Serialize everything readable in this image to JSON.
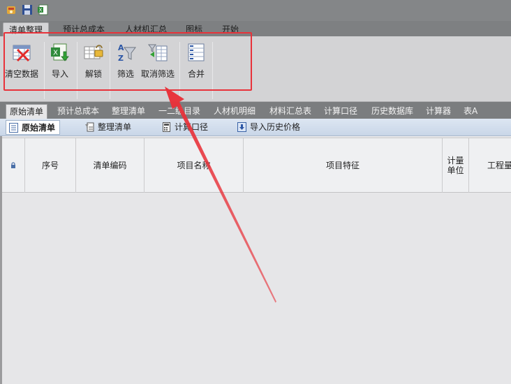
{
  "quick_access": {
    "icons": [
      "app-icon",
      "save-icon",
      "excel-icon"
    ]
  },
  "ribbon_tabs": [
    {
      "label": "清单整理",
      "active": true
    },
    {
      "label": "预计总成本",
      "active": false
    },
    {
      "label": "人材机汇总",
      "active": false
    },
    {
      "label": "图标",
      "active": false
    },
    {
      "label": "开始",
      "active": false
    }
  ],
  "ribbon": {
    "buttons": [
      {
        "label": "清空数据",
        "icon": "clear-data-icon"
      },
      {
        "label": "导入",
        "icon": "import-icon"
      },
      {
        "label": "解锁",
        "icon": "unlock-icon"
      },
      {
        "label": "筛选",
        "icon": "filter-icon"
      },
      {
        "label": "取消筛选",
        "icon": "cancel-filter-icon"
      },
      {
        "label": "合并",
        "icon": "merge-icon"
      }
    ]
  },
  "sheet_tabs": [
    {
      "label": "原始清单",
      "active": true
    },
    {
      "label": "预计总成本",
      "active": false
    },
    {
      "label": "整理清单",
      "active": false
    },
    {
      "label": "一二级目录",
      "active": false
    },
    {
      "label": "人材机明细",
      "active": false
    },
    {
      "label": "材料汇总表",
      "active": false
    },
    {
      "label": "计算口径",
      "active": false
    },
    {
      "label": "历史数据库",
      "active": false
    },
    {
      "label": "计算器",
      "active": false
    },
    {
      "label": "表A",
      "active": false
    }
  ],
  "sub_tabs": [
    {
      "label": "原始清单",
      "active": true,
      "icon": "list-icon"
    },
    {
      "label": "整理清单",
      "active": false,
      "icon": "organize-icon"
    },
    {
      "label": "计算口径",
      "active": false,
      "icon": "calc-icon"
    },
    {
      "label": "导入历史价格",
      "active": false,
      "icon": "import-history-icon"
    }
  ],
  "table": {
    "columns": [
      "序号",
      "清单编码",
      "项目名称",
      "项目特征",
      "计量\n单位",
      "工程量"
    ]
  },
  "annotation": {
    "highlight_color": "#e8323a",
    "arrow_color": "#e8323a"
  }
}
